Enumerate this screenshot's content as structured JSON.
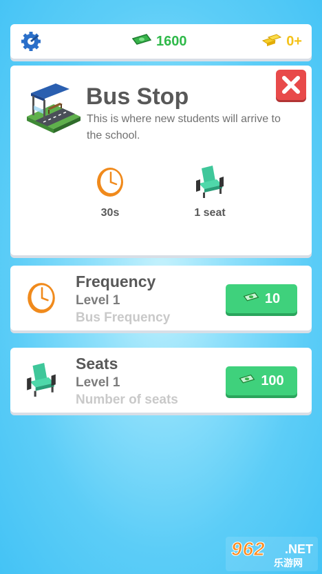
{
  "topbar": {
    "money": "1600",
    "gold": "0+",
    "icons": [
      "settings-gear-icon",
      "cash-icon",
      "gold-bars-icon"
    ]
  },
  "info": {
    "title": "Bus Stop",
    "description": "This is where new students will arrive to the school.",
    "stats": [
      {
        "icon": "clock-icon",
        "label": "30s"
      },
      {
        "icon": "seat-icon",
        "label": "1 seat"
      }
    ]
  },
  "upgrades": [
    {
      "icon": "clock-icon",
      "title": "Frequency",
      "level": "Level 1",
      "subtitle": "Bus Frequency",
      "price": "10"
    },
    {
      "icon": "seat-icon",
      "title": "Seats",
      "level": "Level 1",
      "subtitle": "Number of seats",
      "price": "100"
    }
  ],
  "watermark": {
    "brand": "962",
    "net": ".NET",
    "sub": "乐游网"
  },
  "colors": {
    "accent_green": "#3fd17c",
    "money_green": "#2fb94a",
    "close_red": "#e84a4a",
    "gold": "#f4c21a"
  }
}
